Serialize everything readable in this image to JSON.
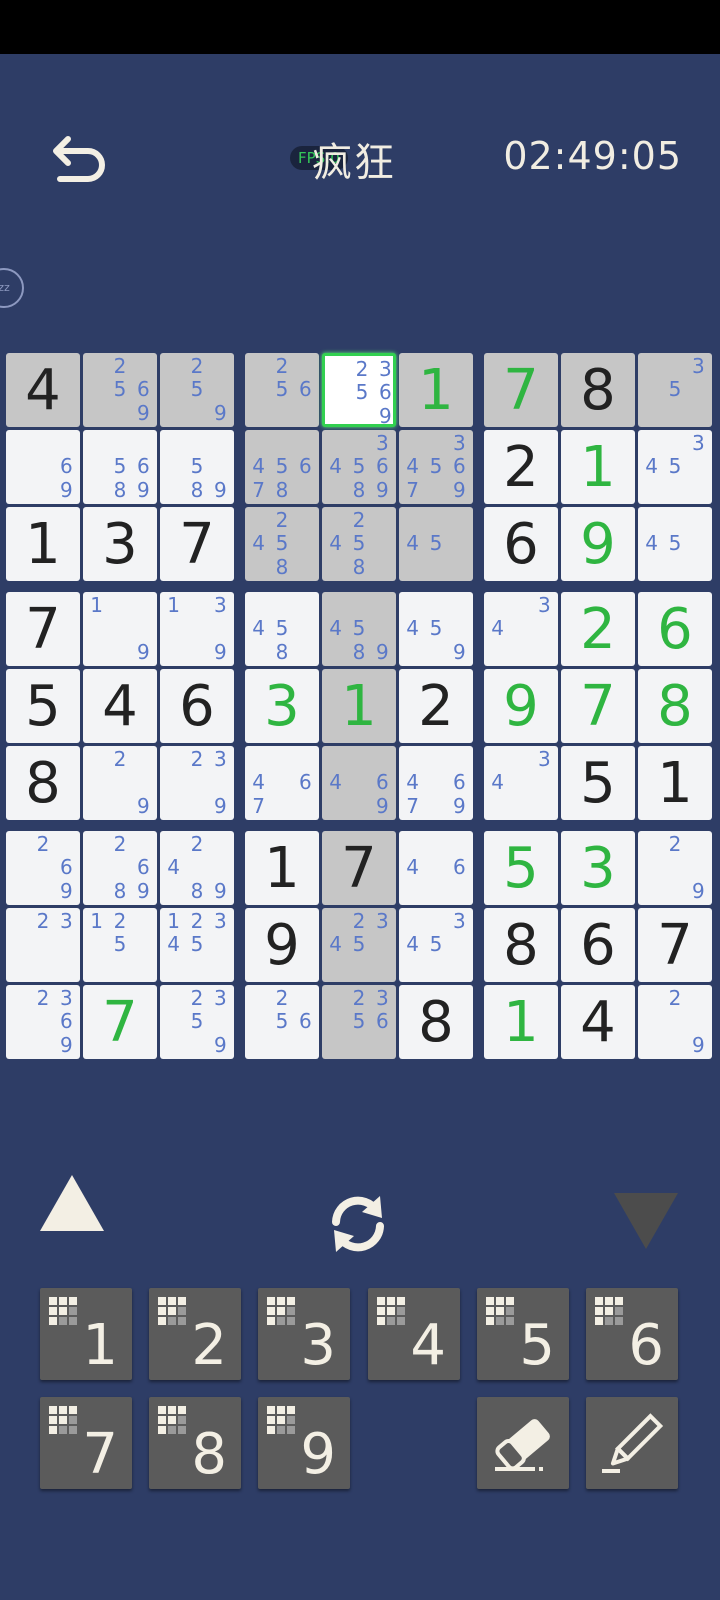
{
  "header": {
    "difficulty": "疯狂",
    "timer": "02:49:05",
    "fps_label": "FPS:0"
  },
  "side_bubble": {
    "label": "zz"
  },
  "board": {
    "rows": [
      [
        {
          "v": "4",
          "t": "given",
          "hl": true
        },
        {
          "n": [
            2,
            5,
            6,
            9
          ],
          "hl": true
        },
        {
          "n": [
            2,
            5,
            9
          ],
          "hl": true
        },
        {
          "n": [
            2,
            5,
            6
          ],
          "hl": true
        },
        {
          "n": [
            2,
            3,
            5,
            6,
            9
          ],
          "sel": true
        },
        {
          "v": "1",
          "t": "user",
          "hl": true
        },
        {
          "v": "7",
          "t": "user",
          "hl": true
        },
        {
          "v": "8",
          "t": "given",
          "hl": true
        },
        {
          "n": [
            3,
            5
          ],
          "hl": true
        }
      ],
      [
        {
          "n": [
            6,
            9
          ]
        },
        {
          "n": [
            5,
            6,
            8,
            9
          ]
        },
        {
          "n": [
            5,
            8,
            9
          ]
        },
        {
          "n": [
            4,
            5,
            6,
            7,
            8
          ],
          "hl": true
        },
        {
          "n": [
            3,
            4,
            5,
            6,
            8,
            9
          ],
          "hl": true
        },
        {
          "n": [
            3,
            4,
            5,
            6,
            7,
            9
          ],
          "hl": true
        },
        {
          "v": "2",
          "t": "given"
        },
        {
          "v": "1",
          "t": "user"
        },
        {
          "n": [
            3,
            4,
            5
          ]
        }
      ],
      [
        {
          "v": "1",
          "t": "given"
        },
        {
          "v": "3",
          "t": "given"
        },
        {
          "v": "7",
          "t": "given"
        },
        {
          "n": [
            2,
            4,
            5,
            8
          ],
          "hl": true
        },
        {
          "n": [
            2,
            4,
            5,
            8
          ],
          "hl": true
        },
        {
          "n": [
            4,
            5
          ],
          "hl": true
        },
        {
          "v": "6",
          "t": "given"
        },
        {
          "v": "9",
          "t": "user"
        },
        {
          "n": [
            4,
            5
          ]
        }
      ],
      [
        {
          "v": "7",
          "t": "given"
        },
        {
          "n": [
            1,
            9
          ]
        },
        {
          "n": [
            1,
            3,
            9
          ]
        },
        {
          "n": [
            4,
            5,
            8
          ]
        },
        {
          "n": [
            4,
            5,
            8,
            9
          ],
          "hl": true
        },
        {
          "n": [
            4,
            5,
            9
          ]
        },
        {
          "n": [
            3,
            4
          ]
        },
        {
          "v": "2",
          "t": "user"
        },
        {
          "v": "6",
          "t": "user"
        }
      ],
      [
        {
          "v": "5",
          "t": "given"
        },
        {
          "v": "4",
          "t": "given"
        },
        {
          "v": "6",
          "t": "given"
        },
        {
          "v": "3",
          "t": "user"
        },
        {
          "v": "1",
          "t": "user",
          "hl": true
        },
        {
          "v": "2",
          "t": "given"
        },
        {
          "v": "9",
          "t": "user"
        },
        {
          "v": "7",
          "t": "user"
        },
        {
          "v": "8",
          "t": "user"
        }
      ],
      [
        {
          "v": "8",
          "t": "given"
        },
        {
          "n": [
            2,
            9
          ]
        },
        {
          "n": [
            2,
            3,
            9
          ]
        },
        {
          "n": [
            4,
            6,
            7
          ]
        },
        {
          "n": [
            4,
            6,
            9
          ],
          "hl": true
        },
        {
          "n": [
            4,
            6,
            7,
            9
          ]
        },
        {
          "n": [
            3,
            4
          ]
        },
        {
          "v": "5",
          "t": "given"
        },
        {
          "v": "1",
          "t": "given"
        }
      ],
      [
        {
          "n": [
            2,
            6,
            9
          ]
        },
        {
          "n": [
            2,
            6,
            8,
            9
          ]
        },
        {
          "n": [
            2,
            4,
            8,
            9
          ]
        },
        {
          "v": "1",
          "t": "given"
        },
        {
          "v": "7",
          "t": "given",
          "hl": true
        },
        {
          "n": [
            4,
            6
          ]
        },
        {
          "v": "5",
          "t": "user"
        },
        {
          "v": "3",
          "t": "user"
        },
        {
          "n": [
            2,
            9
          ]
        }
      ],
      [
        {
          "n": [
            2,
            3
          ]
        },
        {
          "n": [
            1,
            2,
            5
          ]
        },
        {
          "n": [
            1,
            2,
            3,
            4,
            5
          ]
        },
        {
          "v": "9",
          "t": "given"
        },
        {
          "n": [
            2,
            3,
            4,
            5
          ],
          "hl": true
        },
        {
          "n": [
            3,
            4,
            5
          ]
        },
        {
          "v": "8",
          "t": "given"
        },
        {
          "v": "6",
          "t": "given"
        },
        {
          "v": "7",
          "t": "given"
        }
      ],
      [
        {
          "n": [
            2,
            3,
            6,
            9
          ]
        },
        {
          "v": "7",
          "t": "user"
        },
        {
          "n": [
            2,
            3,
            5,
            9
          ]
        },
        {
          "n": [
            2,
            5,
            6
          ]
        },
        {
          "n": [
            2,
            3,
            5,
            6
          ],
          "hl": true
        },
        {
          "v": "8",
          "t": "given"
        },
        {
          "v": "1",
          "t": "user"
        },
        {
          "v": "4",
          "t": "given"
        },
        {
          "n": [
            2,
            9
          ]
        }
      ]
    ]
  },
  "keypad": {
    "digits": [
      "1",
      "2",
      "3",
      "4",
      "5",
      "6",
      "7",
      "8",
      "9"
    ]
  },
  "icons": {
    "undo": "undo-arrow-icon",
    "refresh": "refresh-icon",
    "eraser": "eraser-icon",
    "pencil": "pencil-icon",
    "up": "arrow-up-icon",
    "down": "arrow-down-icon"
  },
  "colors": {
    "background": "#2e3d66",
    "cell": "#f3f4f6",
    "highlight": "#c6c6c6",
    "given_digit": "#222222",
    "user_digit": "#2fb541",
    "note_digit": "#5a78c8",
    "selection": "#32d050",
    "key": "#5b5b5b"
  }
}
